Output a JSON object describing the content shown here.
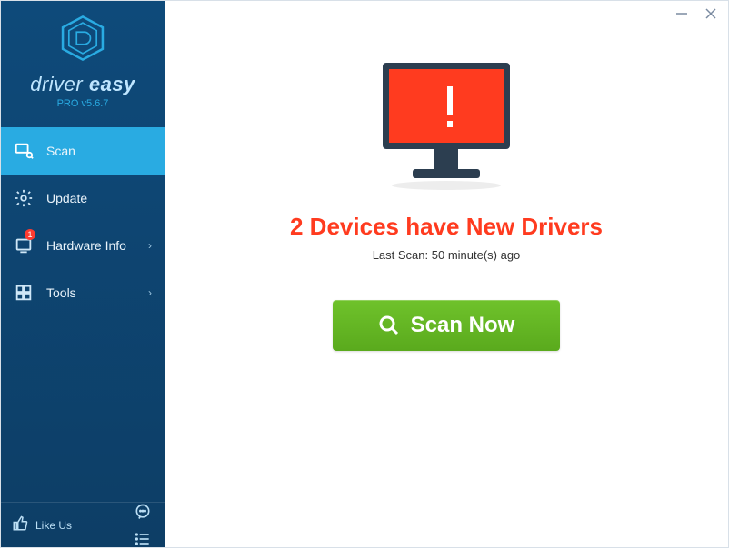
{
  "brand": {
    "name1": "driver",
    "name2": "easy",
    "version": "PRO v5.6.7"
  },
  "sidebar": {
    "items": [
      {
        "label": "Scan"
      },
      {
        "label": "Update"
      },
      {
        "label": "Hardware Info",
        "badge": "1"
      },
      {
        "label": "Tools"
      }
    ],
    "like_us": "Like Us"
  },
  "main": {
    "status_title": "2 Devices have New Drivers",
    "last_scan": "Last Scan: 50 minute(s) ago",
    "scan_button": "Scan Now"
  }
}
